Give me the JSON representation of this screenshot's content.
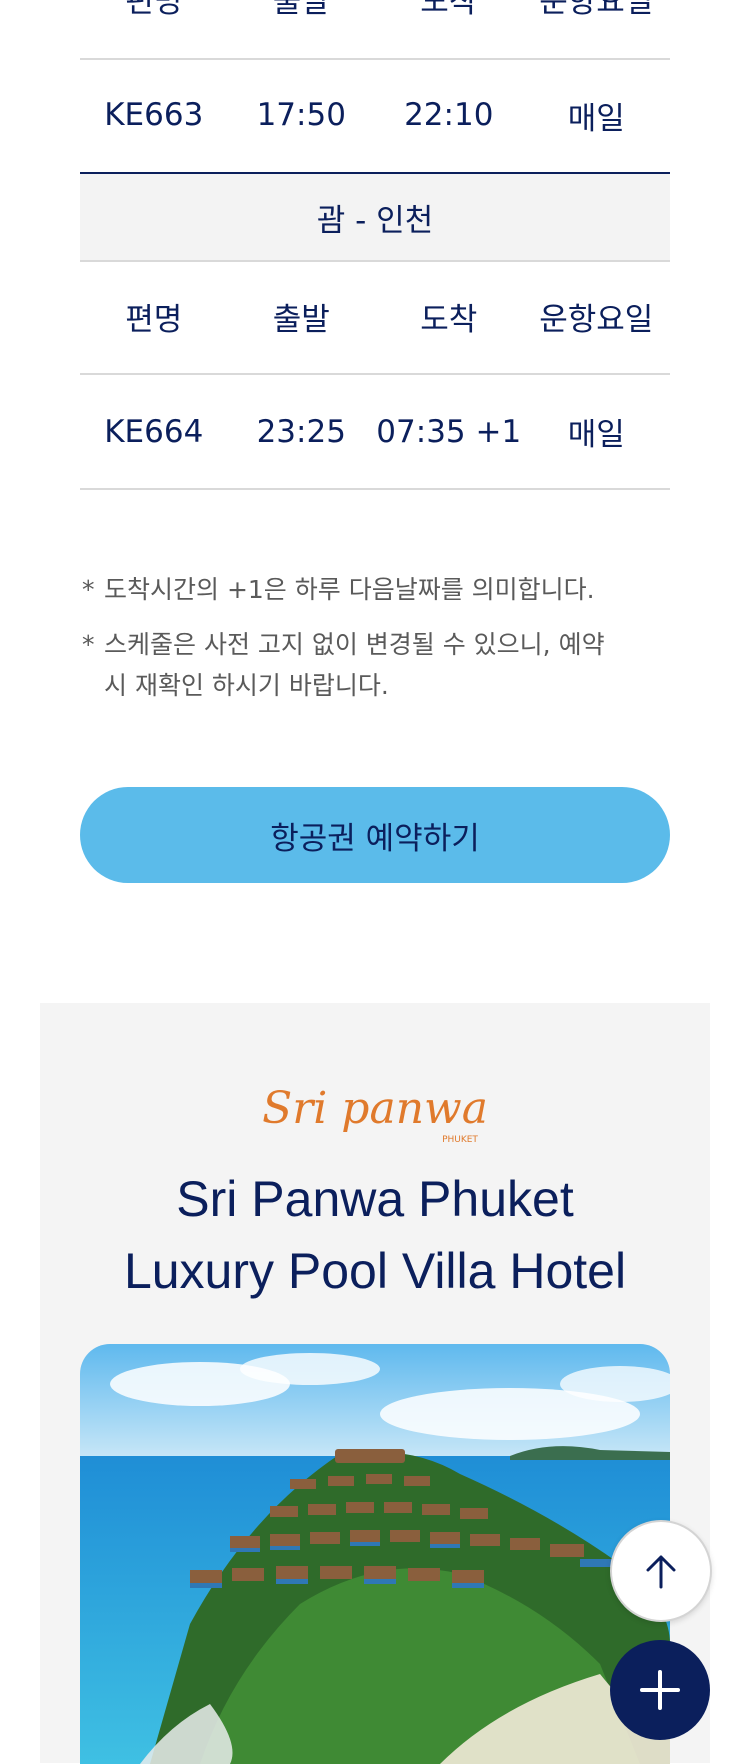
{
  "schedule": {
    "header_row_1": [
      "편명",
      "출발",
      "도착",
      "운항요일"
    ],
    "flight_1": [
      "KE663",
      "17:50",
      "22:10",
      "매일"
    ],
    "section_title": "괌 - 인천",
    "header_row_2": [
      "편명",
      "출발",
      "도착",
      "운항요일"
    ],
    "flight_2": [
      "KE664",
      "23:25",
      "07:35 +1",
      "매일"
    ]
  },
  "notes": {
    "mark": "*",
    "note_1": "도착시간의 +1은 하루 다음날짜를 의미합니다.",
    "note_2_line_1": "스케줄은 사전 고지 없이 변경될 수 있으니, 예약",
    "note_2_line_2": "시 재확인 하시기 바랍니다."
  },
  "book_button": "항공권 예약하기",
  "hotel": {
    "logo_text": "Sri panwa",
    "logo_sub": "PHUKET",
    "title_line_1": "Sri Panwa Phuket",
    "title_line_2": "Luxury Pool Villa Hotel"
  },
  "icons": {
    "scroll_top": "arrow-up-icon",
    "open_menu": "plus-icon"
  },
  "colors": {
    "navy": "#0b1f5c",
    "accent_blue": "#5bbbea",
    "logo_orange": "#e07a2c"
  }
}
